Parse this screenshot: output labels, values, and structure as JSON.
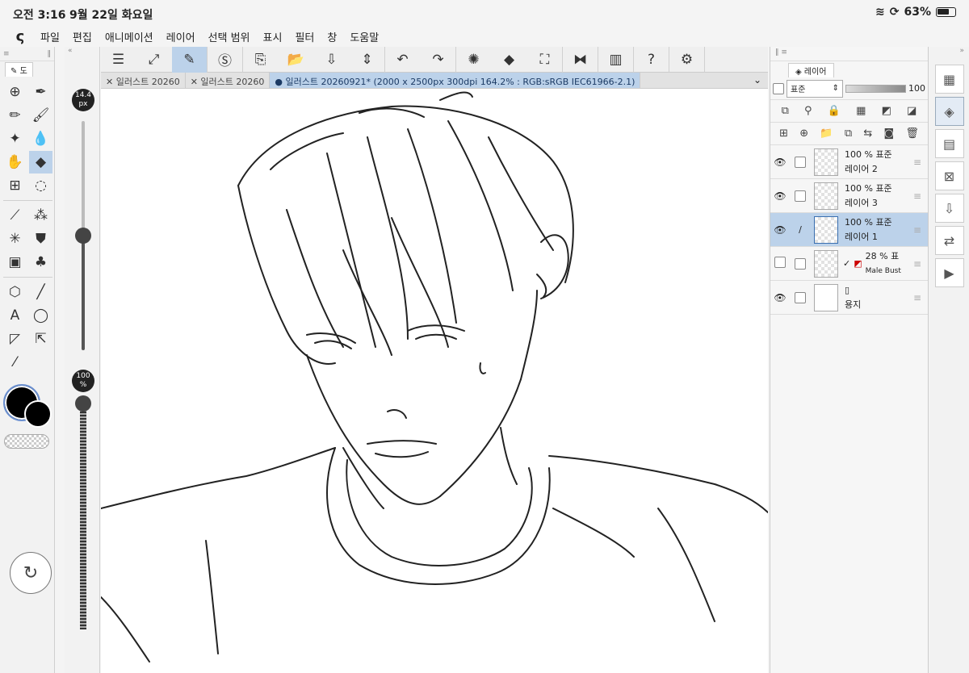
{
  "status": {
    "time": "오전 3:16",
    "date": "9월 22일 화요일",
    "battery": "63%"
  },
  "menu": {
    "items": [
      "파일",
      "편집",
      "애니메이션",
      "레이어",
      "선택 범위",
      "표시",
      "필터",
      "창",
      "도움말"
    ]
  },
  "tools": {
    "tab_label": "도",
    "brush_size": "14.4\npx",
    "brush_size_value": 14.4,
    "opacity": "100\n%",
    "opacity_value": 100
  },
  "documents": {
    "tabs": [
      {
        "label": "일러스트 20260"
      },
      {
        "label": "일러스트 20260"
      },
      {
        "label": "● 일러스트 20260921* (2000 x 2500px 300dpi 164.2% : RGB:sRGB IEC61966-2.1)"
      }
    ]
  },
  "layers": {
    "panel_title": "레이어",
    "blend_mode": "표준",
    "opacity": "100",
    "items": [
      {
        "opacity": "100 % 표준",
        "name": "레이어 2",
        "active": false
      },
      {
        "opacity": "100 % 표준",
        "name": "레이어 3",
        "active": false
      },
      {
        "opacity": "100 % 표준",
        "name": "레이어 1",
        "active": true
      },
      {
        "opacity": "28 % 표",
        "name": "Male Bust",
        "active": false
      },
      {
        "opacity": "",
        "name": "용지",
        "active": false
      }
    ]
  },
  "colors": {
    "accent": "#bcd2ea",
    "main_color": "#000000",
    "sub_color": "#000000"
  }
}
